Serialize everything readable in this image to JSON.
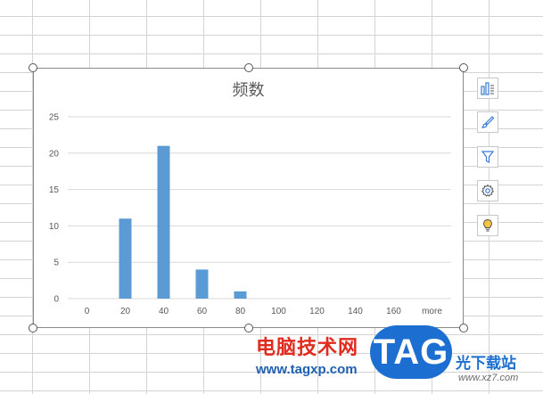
{
  "chart_data": {
    "type": "bar",
    "title": "频数",
    "categories": [
      "0",
      "20",
      "40",
      "60",
      "80",
      "100",
      "120",
      "140",
      "160",
      "more"
    ],
    "values": [
      0,
      11,
      21,
      4,
      1,
      0,
      0,
      0,
      0,
      0
    ],
    "ylim": [
      0,
      25
    ],
    "yticks": [
      0,
      5,
      10,
      15,
      20,
      25
    ],
    "grid": true,
    "bar_color": "#5b9bd5"
  },
  "tools": [
    {
      "name": "chart-elements-icon"
    },
    {
      "name": "chart-styles-icon"
    },
    {
      "name": "chart-filter-icon"
    },
    {
      "name": "chart-settings-icon"
    },
    {
      "name": "chart-tips-icon"
    }
  ],
  "watermark": {
    "site_cn": "电脑技术网",
    "url": "www.tagxp.com",
    "logo": "TAG",
    "site2_cn": "光下载站",
    "url2": "www.xz7.com"
  }
}
